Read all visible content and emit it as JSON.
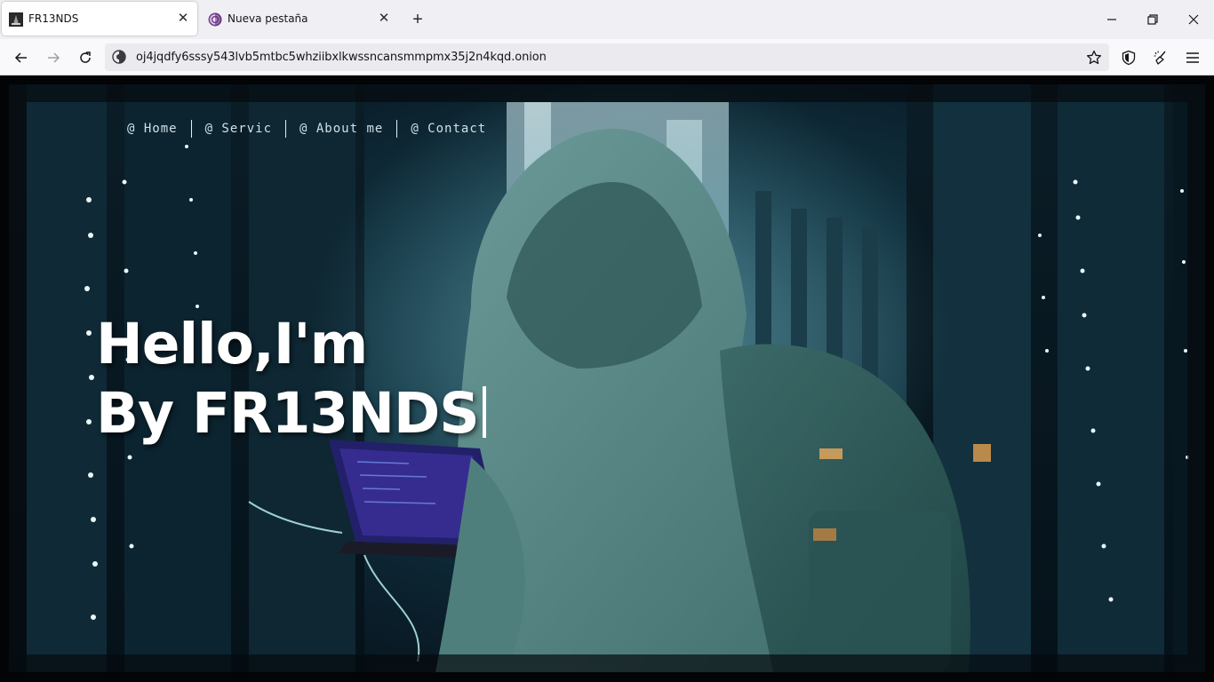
{
  "browser": {
    "tabs": [
      {
        "title": "FR13NDS",
        "active": true,
        "favicon": "site-favicon-icon"
      },
      {
        "title": "Nueva pestaña",
        "active": false,
        "favicon": "tor-onion-icon"
      }
    ],
    "address": "oj4jqdfy6sssy543lvb5mtbc5whziibxlkwssncansmmpmx35j2n4kqd.onion"
  },
  "site": {
    "nav": [
      {
        "label": "@ Home"
      },
      {
        "label": "@ Servic"
      },
      {
        "label": "@ About me"
      },
      {
        "label": "@ Contact"
      }
    ],
    "headline_line1": "Hello,I'm",
    "headline_line2": "By FR13NDS"
  },
  "colors": {
    "tab_active_bg": "#ffffff",
    "chrome_bg": "#f0f0f4",
    "hero_teal": "#2b4f5c",
    "headline": "#ffffff"
  }
}
